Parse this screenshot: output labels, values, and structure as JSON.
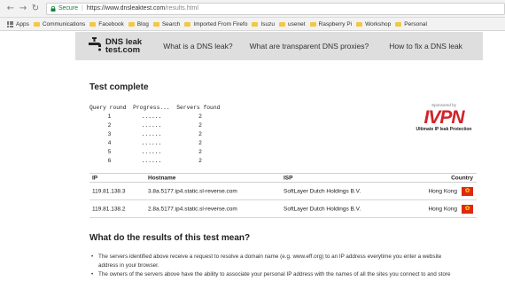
{
  "browser": {
    "secure_label": "Secure",
    "url_host": "https://www.dnsleaktest.com",
    "url_path": "/results.html"
  },
  "bookmarks": [
    {
      "label": "Apps",
      "icon": "apps-grid-icon"
    },
    {
      "label": "Communications",
      "icon": "folder-icon"
    },
    {
      "label": "Facebook",
      "icon": "folder-icon"
    },
    {
      "label": "Blog",
      "icon": "folder-icon"
    },
    {
      "label": "Search",
      "icon": "folder-icon"
    },
    {
      "label": "Imported From Firefo",
      "icon": "folder-icon"
    },
    {
      "label": "Isuzu",
      "icon": "folder-icon"
    },
    {
      "label": "usenet",
      "icon": "folder-icon"
    },
    {
      "label": "Raspberry Pi",
      "icon": "folder-icon"
    },
    {
      "label": "Workshop",
      "icon": "folder-icon"
    },
    {
      "label": "Personal",
      "icon": "folder-icon"
    }
  ],
  "site": {
    "logo_line1": "DNS leak",
    "logo_line2": "test.com",
    "nav": [
      "What is a DNS leak?",
      "What are transparent DNS proxies?",
      "How to fix a DNS leak"
    ]
  },
  "results": {
    "heading": "Test complete",
    "columns_header": "Query round  Progress...  Servers found",
    "rounds": [
      {
        "round": "1",
        "progress": "......",
        "servers": "2"
      },
      {
        "round": "2",
        "progress": "......",
        "servers": "2"
      },
      {
        "round": "3",
        "progress": "......",
        "servers": "2"
      },
      {
        "round": "4",
        "progress": "......",
        "servers": "2"
      },
      {
        "round": "5",
        "progress": "......",
        "servers": "2"
      },
      {
        "round": "6",
        "progress": "......",
        "servers": "2"
      }
    ]
  },
  "sponsor": {
    "label": "Sponsored by",
    "brand": "IVPN",
    "tagline": "Ultimate IP leak Protection"
  },
  "table": {
    "headers": {
      "ip": "IP",
      "hostname": "Hostname",
      "isp": "ISP",
      "country": "Country"
    },
    "rows": [
      {
        "ip": "119.81.138.3",
        "hostname": "3.8a.5177.ip4.static.sl-reverse.com",
        "isp": "SoftLayer Dutch Holdings B.V.",
        "country": "Hong Kong",
        "flag_icon": "hong-kong-flag-icon"
      },
      {
        "ip": "119.81.138.2",
        "hostname": "2.8a.5177.ip4.static.sl-reverse.com",
        "isp": "SoftLayer Dutch Holdings B.V.",
        "country": "Hong Kong",
        "flag_icon": "hong-kong-flag-icon"
      }
    ]
  },
  "explanation": {
    "heading": "What do the results of this test mean?",
    "bullet1_line1": "The servers identified above receive a request to resolve a domain name (e.g. www.eff.org) to an IP address everytime you enter a website",
    "bullet1_line2": "address in your browser.",
    "bullet2_line1": "The owners of the servers above have the ability to associate your personal IP address with the names of all the sites you connect to and store"
  },
  "colors": {
    "header_bg": "#dedede",
    "brand_red": "#d2232a",
    "secure_green": "#188038",
    "flag_red": "#de2910"
  }
}
